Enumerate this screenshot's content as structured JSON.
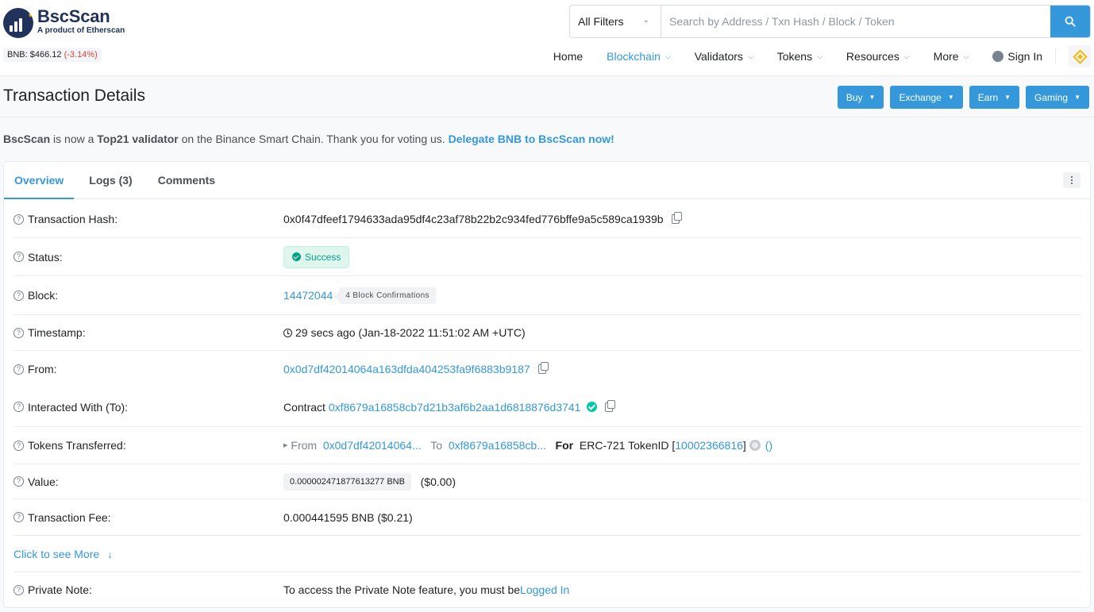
{
  "brand": {
    "name": "BscScan",
    "tagline": "A product of Etherscan",
    "price_label": "BNB: $466.12",
    "price_change": "(-3.14%)"
  },
  "search": {
    "filter_label": "All Filters",
    "placeholder": "Search by Address / Txn Hash / Block / Token"
  },
  "nav": {
    "home": "Home",
    "blockchain": "Blockchain",
    "validators": "Validators",
    "tokens": "Tokens",
    "resources": "Resources",
    "more": "More",
    "sign_in": "Sign In"
  },
  "page": {
    "title": "Transaction Details",
    "buttons": {
      "buy": "Buy",
      "exchange": "Exchange",
      "earn": "Earn",
      "gaming": "Gaming"
    }
  },
  "notice": {
    "brand": "BscScan",
    "text1": " is now a ",
    "highlight": "Top21 validator",
    "text2": " on the Binance Smart Chain. Thank you for voting us. ",
    "link": "Delegate BNB to BscScan now!"
  },
  "tabs": {
    "overview": "Overview",
    "logs": "Logs (3)",
    "comments": "Comments"
  },
  "tx": {
    "hash_label": "Transaction Hash:",
    "hash": "0x0f47dfeef1794633ada95df4c23af78b22b2c934fed776bffe9a5c589ca1939b",
    "status_label": "Status:",
    "status": "Success",
    "block_label": "Block:",
    "block": "14472044",
    "confirmations": "4 Block Confirmations",
    "timestamp_label": "Timestamp:",
    "timestamp": "29 secs ago (Jan-18-2022 11:51:02 AM +UTC)",
    "from_label": "From:",
    "from": "0x0d7df42014064a163dfda404253fa9f6883b9187",
    "to_label": "Interacted With (To):",
    "to_prefix": "Contract",
    "to": "0xf8679a16858cb7d21b3af6b2aa1d6818876d3741",
    "tokens_label": "Tokens Transferred:",
    "tokens": {
      "from_word": "From",
      "from_addr": "0x0d7df42014064...",
      "to_word": "To",
      "to_addr": "0xf8679a16858cb...",
      "for_word": "For",
      "token_type": "ERC-721 TokenID [",
      "token_id": "10002366816",
      "close_bracket": "]",
      "token_name": "()"
    },
    "value_label": "Value:",
    "value": "0.000002471877613277 BNB",
    "value_usd": "($0.00)",
    "fee_label": "Transaction Fee:",
    "fee": "0.000441595 BNB ($0.21)",
    "see_more": "Click to see More",
    "note_label": "Private Note:",
    "note_text": "To access the Private Note feature, you must be ",
    "note_link": "Logged In"
  }
}
